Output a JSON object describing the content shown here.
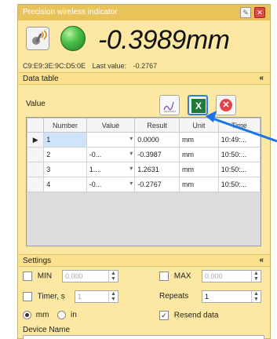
{
  "window": {
    "title": "Precision wireless indicator",
    "pin_icon": "pin-icon",
    "close_icon": "close-icon"
  },
  "readout": {
    "value": "-0.3989mm",
    "led_color": "#4cc24a",
    "mac": "C9:E9:3E:9C:D5:0E",
    "last_value_label": "Last value:",
    "last_value": "-0.2767"
  },
  "data_table": {
    "header": "Data table",
    "value_label": "Value",
    "toolbar": [
      "chart-icon",
      "excel-export-icon",
      "cancel-icon"
    ],
    "columns": [
      "Number",
      "Value",
      "Result",
      "Unit",
      "Time"
    ],
    "rows": [
      {
        "number": "1",
        "value": "",
        "result": "0.0000",
        "unit": "mm",
        "time": "10:49:..."
      },
      {
        "number": "2",
        "value": "-0...",
        "result": "-0.3987",
        "unit": "mm",
        "time": "10:50:..."
      },
      {
        "number": "3",
        "value": "1....",
        "result": "1.2631",
        "unit": "mm",
        "time": "10:50:..."
      },
      {
        "number": "4",
        "value": "-0...",
        "result": "-0.2767",
        "unit": "mm",
        "time": "10:50:..."
      }
    ]
  },
  "settings": {
    "header": "Settings",
    "min_label": "MIN",
    "min_value": "0.000",
    "max_label": "MAX",
    "max_value": "0.000",
    "timer_label": "Timer, s",
    "timer_value": "1",
    "repeats_label": "Repeats",
    "repeats_value": "1",
    "unit_mm": "mm",
    "unit_in": "in",
    "resend_label": "Resend data",
    "device_name_label": "Device Name"
  },
  "colors": {
    "panel": "#fce8a2",
    "titlebar": "#e8c35a",
    "annotation_arrow": "#1a73e8"
  }
}
